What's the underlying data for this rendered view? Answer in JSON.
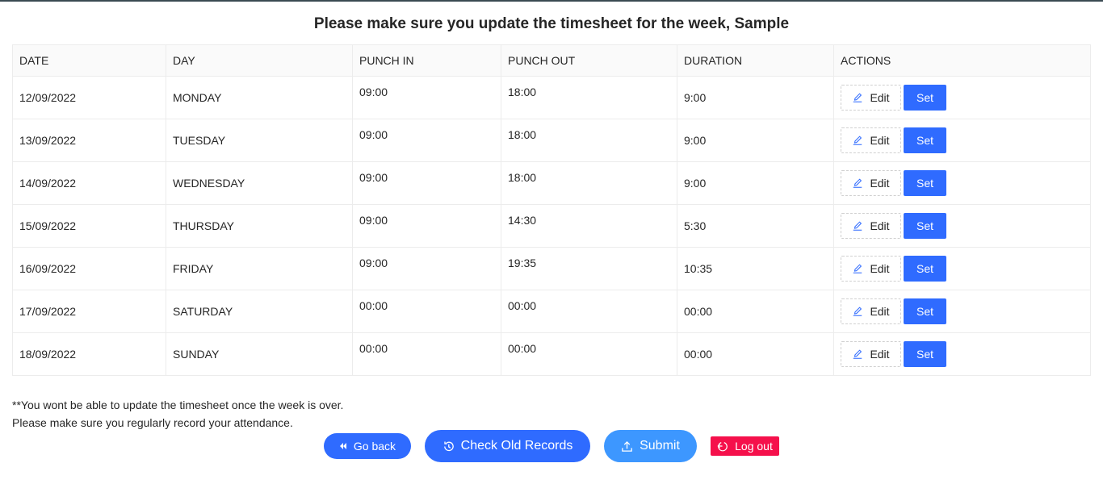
{
  "title": "Please make sure you update the timesheet for the week, Sample",
  "table": {
    "headers": [
      "DATE",
      "DAY",
      "PUNCH IN",
      "PUNCH OUT",
      "DURATION",
      "ACTIONS"
    ],
    "rows": [
      {
        "date": "12/09/2022",
        "day": "MONDAY",
        "punch_in": "09:00",
        "punch_out": "18:00",
        "duration": "9:00"
      },
      {
        "date": "13/09/2022",
        "day": "TUESDAY",
        "punch_in": "09:00",
        "punch_out": "18:00",
        "duration": "9:00"
      },
      {
        "date": "14/09/2022",
        "day": "WEDNESDAY",
        "punch_in": "09:00",
        "punch_out": "18:00",
        "duration": "9:00"
      },
      {
        "date": "15/09/2022",
        "day": "THURSDAY",
        "punch_in": "09:00",
        "punch_out": "14:30",
        "duration": "5:30"
      },
      {
        "date": "16/09/2022",
        "day": "FRIDAY",
        "punch_in": "09:00",
        "punch_out": "19:35",
        "duration": "10:35"
      },
      {
        "date": "17/09/2022",
        "day": "SATURDAY",
        "punch_in": "00:00",
        "punch_out": "00:00",
        "duration": "00:00"
      },
      {
        "date": "18/09/2022",
        "day": "SUNDAY",
        "punch_in": "00:00",
        "punch_out": "00:00",
        "duration": "00:00"
      }
    ],
    "edit_label": "Edit",
    "set_label": "Set"
  },
  "notes": {
    "line1": "**You wont be able to update the timesheet once the week is over.",
    "line2": "Please make sure you regularly record your attendance."
  },
  "footer": {
    "go_back": "Go back",
    "check_old_records": "Check Old Records",
    "submit": "Submit",
    "log_out": "Log out"
  },
  "icons": {
    "edit": "edit-icon",
    "go_back": "fast-backward-icon",
    "check_old_records": "history-clock-icon",
    "submit": "upload-icon",
    "log_out": "logout-icon"
  },
  "colors": {
    "primary": "#2f6bff",
    "submit": "#3d97ff",
    "danger": "#f5104b",
    "header_bg": "#fafafa",
    "border": "#ececec"
  }
}
